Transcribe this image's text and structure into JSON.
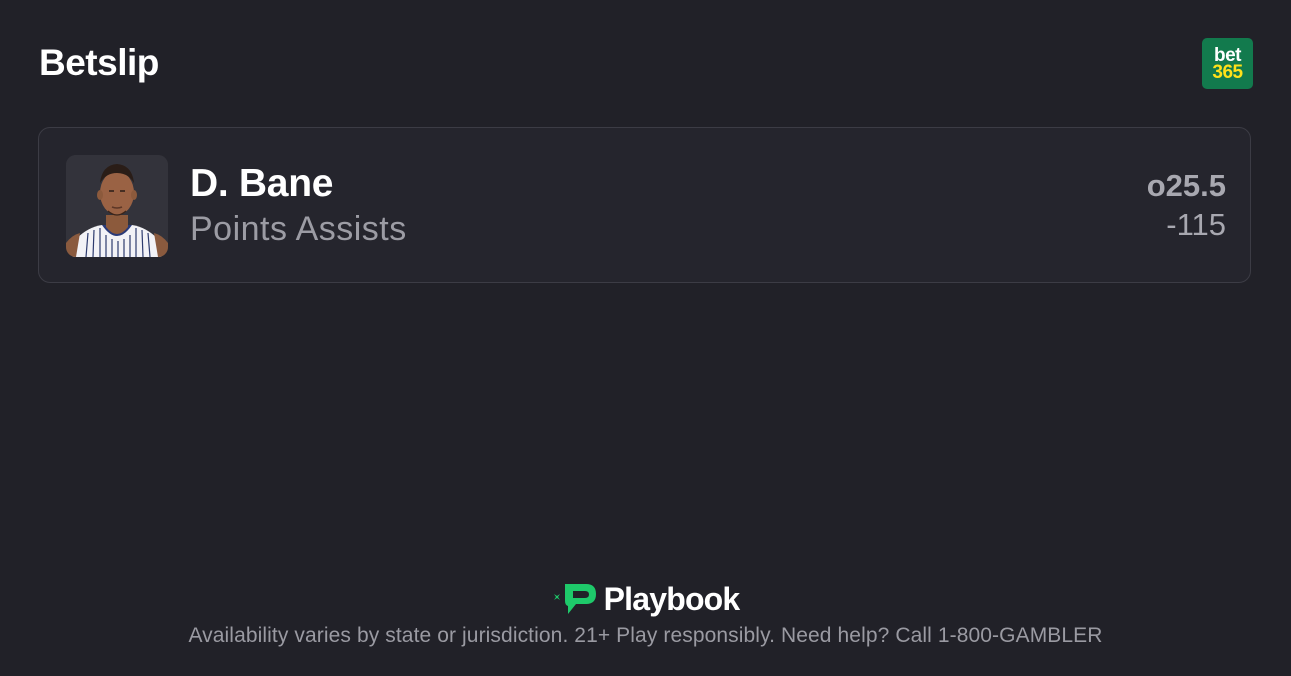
{
  "header": {
    "title": "Betslip",
    "sportsbook_logo": {
      "line1": "bet",
      "line2": "365",
      "bg_color": "#127a4d",
      "accent_color": "#ffe11a"
    }
  },
  "bets": [
    {
      "player_name": "D. Bane",
      "market": "Points Assists",
      "line": "o25.5",
      "odds": "-115",
      "avatar_icon": "player-headshot"
    }
  ],
  "footer": {
    "brand_name": "Playbook",
    "brand_color": "#1ec96a",
    "disclaimer": "Availability varies by state or jurisdiction. 21+ Play responsibly. Need help? Call 1-800-GAMBLER"
  }
}
